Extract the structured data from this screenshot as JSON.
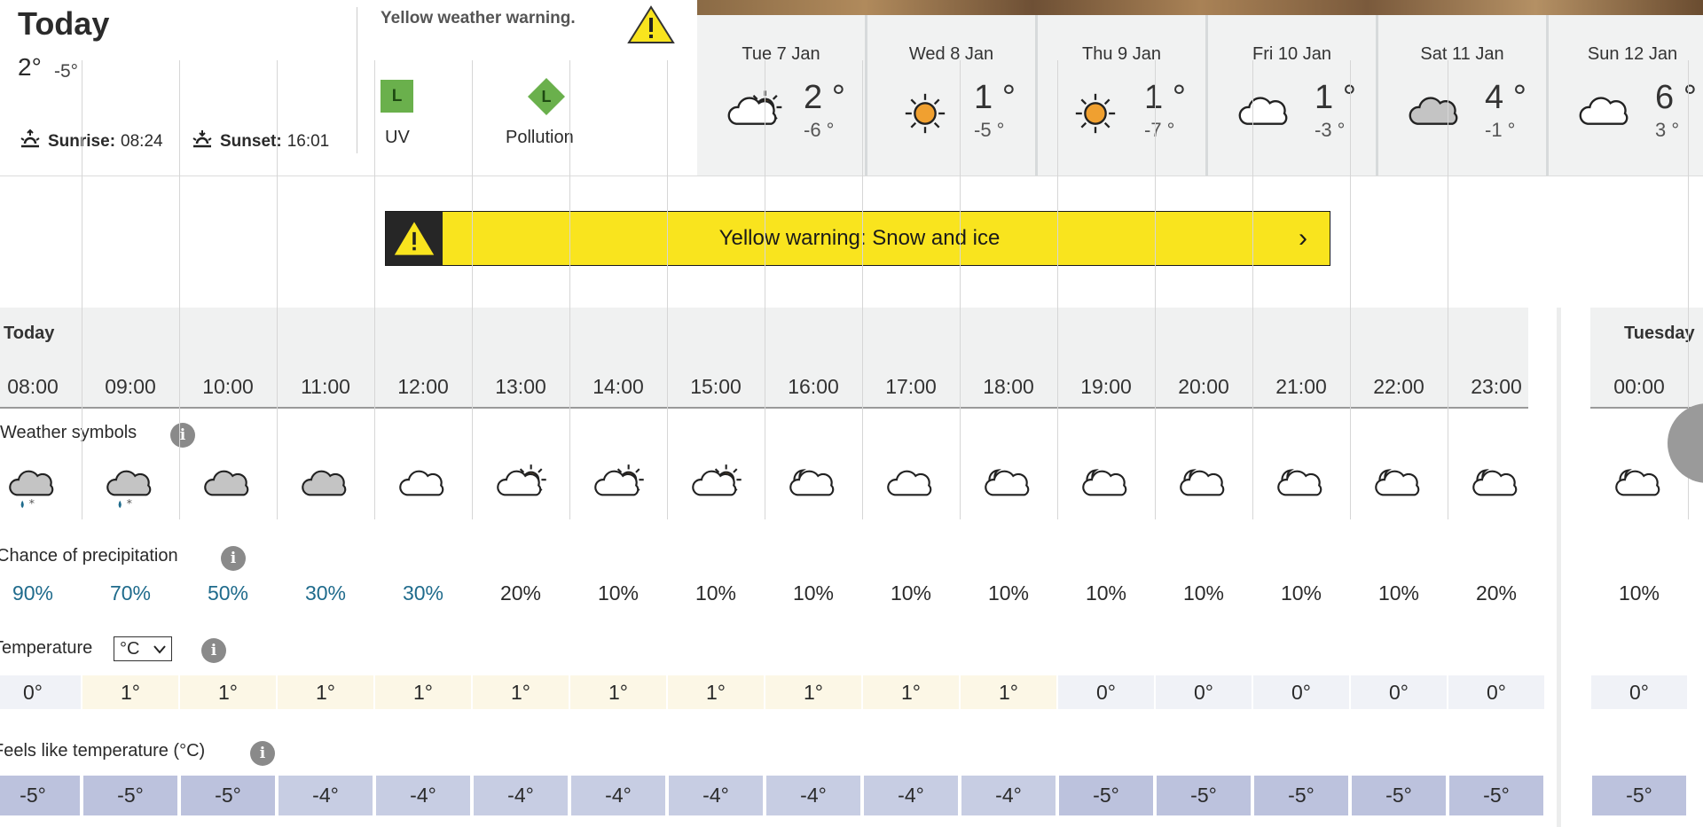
{
  "header": {
    "title": "Today",
    "high": "2°",
    "low": "-5°",
    "sunrise_label": "Sunrise:",
    "sunrise_time": "08:24",
    "sunset_label": "Sunset:",
    "sunset_time": "16:01",
    "warning_heading": "Yellow weather warning.",
    "uv_level": "L",
    "uv_label": "UV",
    "pollution_level": "L",
    "pollution_label": "Pollution"
  },
  "days": [
    {
      "name": "Tue 7 Jan",
      "high": "2 °",
      "low": "-6 °",
      "icon": "sun-cloud-icon"
    },
    {
      "name": "Wed 8 Jan",
      "high": "1 °",
      "low": "-5 °",
      "icon": "sun-icon"
    },
    {
      "name": "Thu 9 Jan",
      "high": "1 °",
      "low": "-7 °",
      "icon": "sun-icon"
    },
    {
      "name": "Fri 10 Jan",
      "high": "1 °",
      "low": "-3 °",
      "icon": "cloud-icon"
    },
    {
      "name": "Sat 11 Jan",
      "high": "4 °",
      "low": "-1 °",
      "icon": "grey-cloud-icon"
    },
    {
      "name": "Sun 12 Jan",
      "high": "6 °",
      "low": "3 °",
      "icon": "cloud-icon"
    }
  ],
  "banner": {
    "text": "Yellow warning: Snow and ice",
    "chevron": "›"
  },
  "hourly": {
    "today_label": "Today",
    "tuesday_label": "Tuesday",
    "hours": [
      "08:00",
      "09:00",
      "10:00",
      "11:00",
      "12:00",
      "13:00",
      "14:00",
      "15:00",
      "16:00",
      "17:00",
      "18:00",
      "19:00",
      "20:00",
      "21:00",
      "22:00",
      "23:00"
    ],
    "next_hours": [
      "00:00"
    ],
    "symbols_label": "Weather symbols",
    "precip_label": "Chance of precipitation",
    "temperature_label": "Temperature",
    "unit": "°C",
    "feels_label": "Feels like temperature (°C)",
    "precip": [
      "90%",
      "70%",
      "50%",
      "30%",
      "30%",
      "20%",
      "10%",
      "10%",
      "10%",
      "10%",
      "10%",
      "10%",
      "10%",
      "10%",
      "10%",
      "20%"
    ],
    "next_precip": [
      "10%"
    ],
    "temps": [
      "0°",
      "1°",
      "1°",
      "1°",
      "1°",
      "1°",
      "1°",
      "1°",
      "1°",
      "1°",
      "1°",
      "0°",
      "0°",
      "0°",
      "0°",
      "0°"
    ],
    "next_temps": [
      "0°"
    ],
    "feels": [
      "-5°",
      "-5°",
      "-5°",
      "-4°",
      "-4°",
      "-4°",
      "-4°",
      "-4°",
      "-4°",
      "-4°",
      "-4°",
      "-5°",
      "-5°",
      "-5°",
      "-5°",
      "-5°"
    ],
    "next_feels": [
      "-5°"
    ],
    "symbols": [
      "sleet-cloud-icon",
      "sleet-cloud-icon",
      "grey-cloud-icon",
      "grey-cloud-icon",
      "cloud-icon",
      "sun-cloud-icon",
      "sun-cloud-icon",
      "sun-cloud-icon",
      "moon-cloud-icon",
      "cloud-icon",
      "moon-cloud-icon",
      "moon-cloud-icon",
      "moon-cloud-icon",
      "moon-cloud-icon",
      "moon-cloud-icon",
      "moon-cloud-icon"
    ],
    "next_symbols": [
      "moon-cloud-icon"
    ],
    "info_glyph": "i"
  },
  "colors": {
    "warning_yellow": "#f9e41e",
    "precip_high": "#1f6b8c",
    "precip_low": "#2a2a2a",
    "warm_cell": "#fcf7e6",
    "cold_cell": "#f0f2f7",
    "feels_cell": "#c7cde3",
    "sun": "#f0a030"
  }
}
